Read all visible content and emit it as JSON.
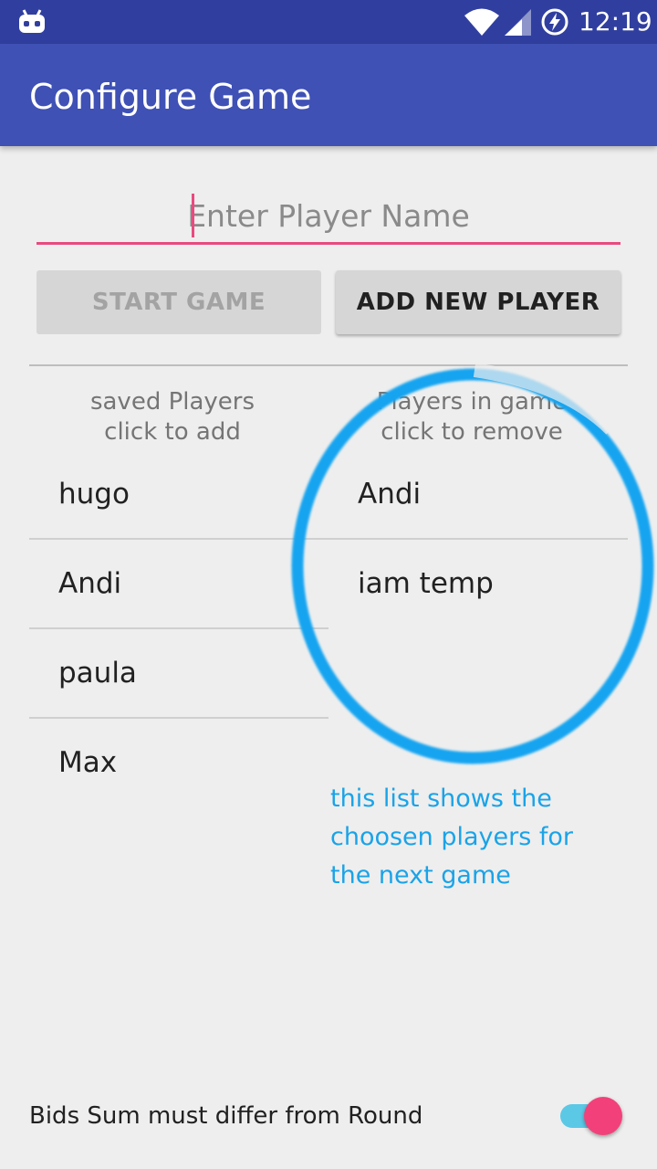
{
  "status_bar": {
    "time": "12:19",
    "icons": [
      "android-debug-icon",
      "wifi-icon",
      "signal-icon",
      "battery-charging-icon"
    ]
  },
  "app_bar": {
    "title": "Configure Game"
  },
  "player_name_input": {
    "value": "",
    "placeholder": "Enter Player Name"
  },
  "buttons": {
    "start_game": "START GAME",
    "add_new_player": "ADD NEW PLAYER"
  },
  "saved_players": {
    "header_line1": "saved Players",
    "header_line2": "click to add",
    "items": [
      "hugo",
      "Andi",
      "paula",
      "Max"
    ]
  },
  "players_in_game": {
    "header_line1": "Players in game",
    "header_line2": "click to remove",
    "items": [
      "Andi",
      "iam temp"
    ]
  },
  "annotation": {
    "line1": "this list shows the",
    "line2": "choosen players for",
    "line3": "the next game",
    "color": "#1aa3e8"
  },
  "settings": {
    "bids_rule_label": "Bids Sum must differ from Round",
    "bids_rule_enabled": true
  },
  "colors": {
    "primary_dark": "#303f9f",
    "primary": "#3f51b5",
    "accent": "#e84a7f",
    "background": "#eeeeee"
  }
}
